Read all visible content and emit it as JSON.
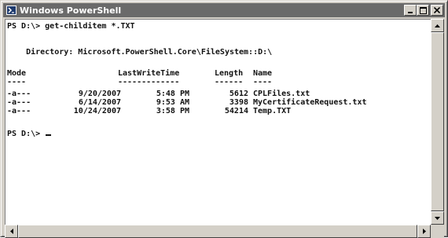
{
  "window": {
    "title": "Windows PowerShell",
    "icon": "powershell-icon",
    "controls": [
      "minimize-icon",
      "maximize-icon",
      "close-icon"
    ]
  },
  "console": {
    "prompt_command": "PS D:\\> get-childitem *.TXT",
    "directory_line": "    Directory: Microsoft.PowerShell.Core\\FileSystem::D:\\",
    "header": {
      "mode": "Mode",
      "last_write_time": "LastWriteTime",
      "length": "Length",
      "name": "Name"
    },
    "underline": {
      "mode": "----",
      "last_write_time": "-------------",
      "length": "------",
      "name": "----"
    },
    "rows": [
      {
        "mode": "-a---",
        "date": "9/20/2007",
        "time": "5:48 PM",
        "length": "5612",
        "name": "CPLFiles.txt"
      },
      {
        "mode": "-a---",
        "date": "6/14/2007",
        "time": "9:53 AM",
        "length": "3398",
        "name": "MyCertificateRequest.txt"
      },
      {
        "mode": "-a---",
        "date": "10/24/2007",
        "time": "3:58 PM",
        "length": "54214",
        "name": "Temp.TXT"
      }
    ],
    "prompt_end": "PS D:\\> "
  }
}
